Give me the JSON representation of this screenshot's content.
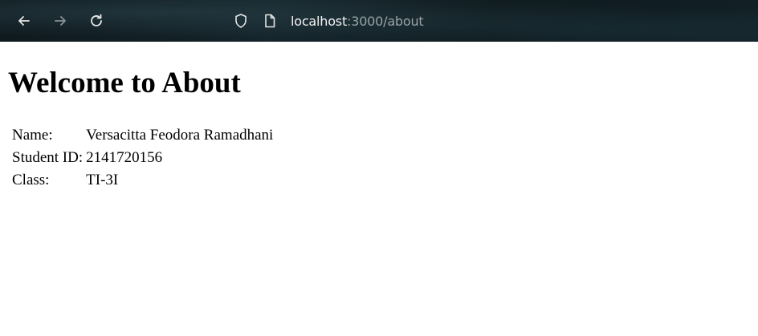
{
  "browser": {
    "url_host": "localhost",
    "url_path": ":3000/about",
    "icons": {
      "back": "arrow-left-icon",
      "forward": "arrow-right-icon",
      "reload": "reload-icon",
      "shield": "shield-icon",
      "page": "page-icon"
    }
  },
  "page": {
    "heading": "Welcome to About",
    "rows": [
      {
        "label": "Name:",
        "value": "Versacitta Feodora Ramadhani"
      },
      {
        "label": "Student ID:",
        "value": "2141720156"
      },
      {
        "label": "Class:",
        "value": "TI-3I"
      }
    ]
  }
}
